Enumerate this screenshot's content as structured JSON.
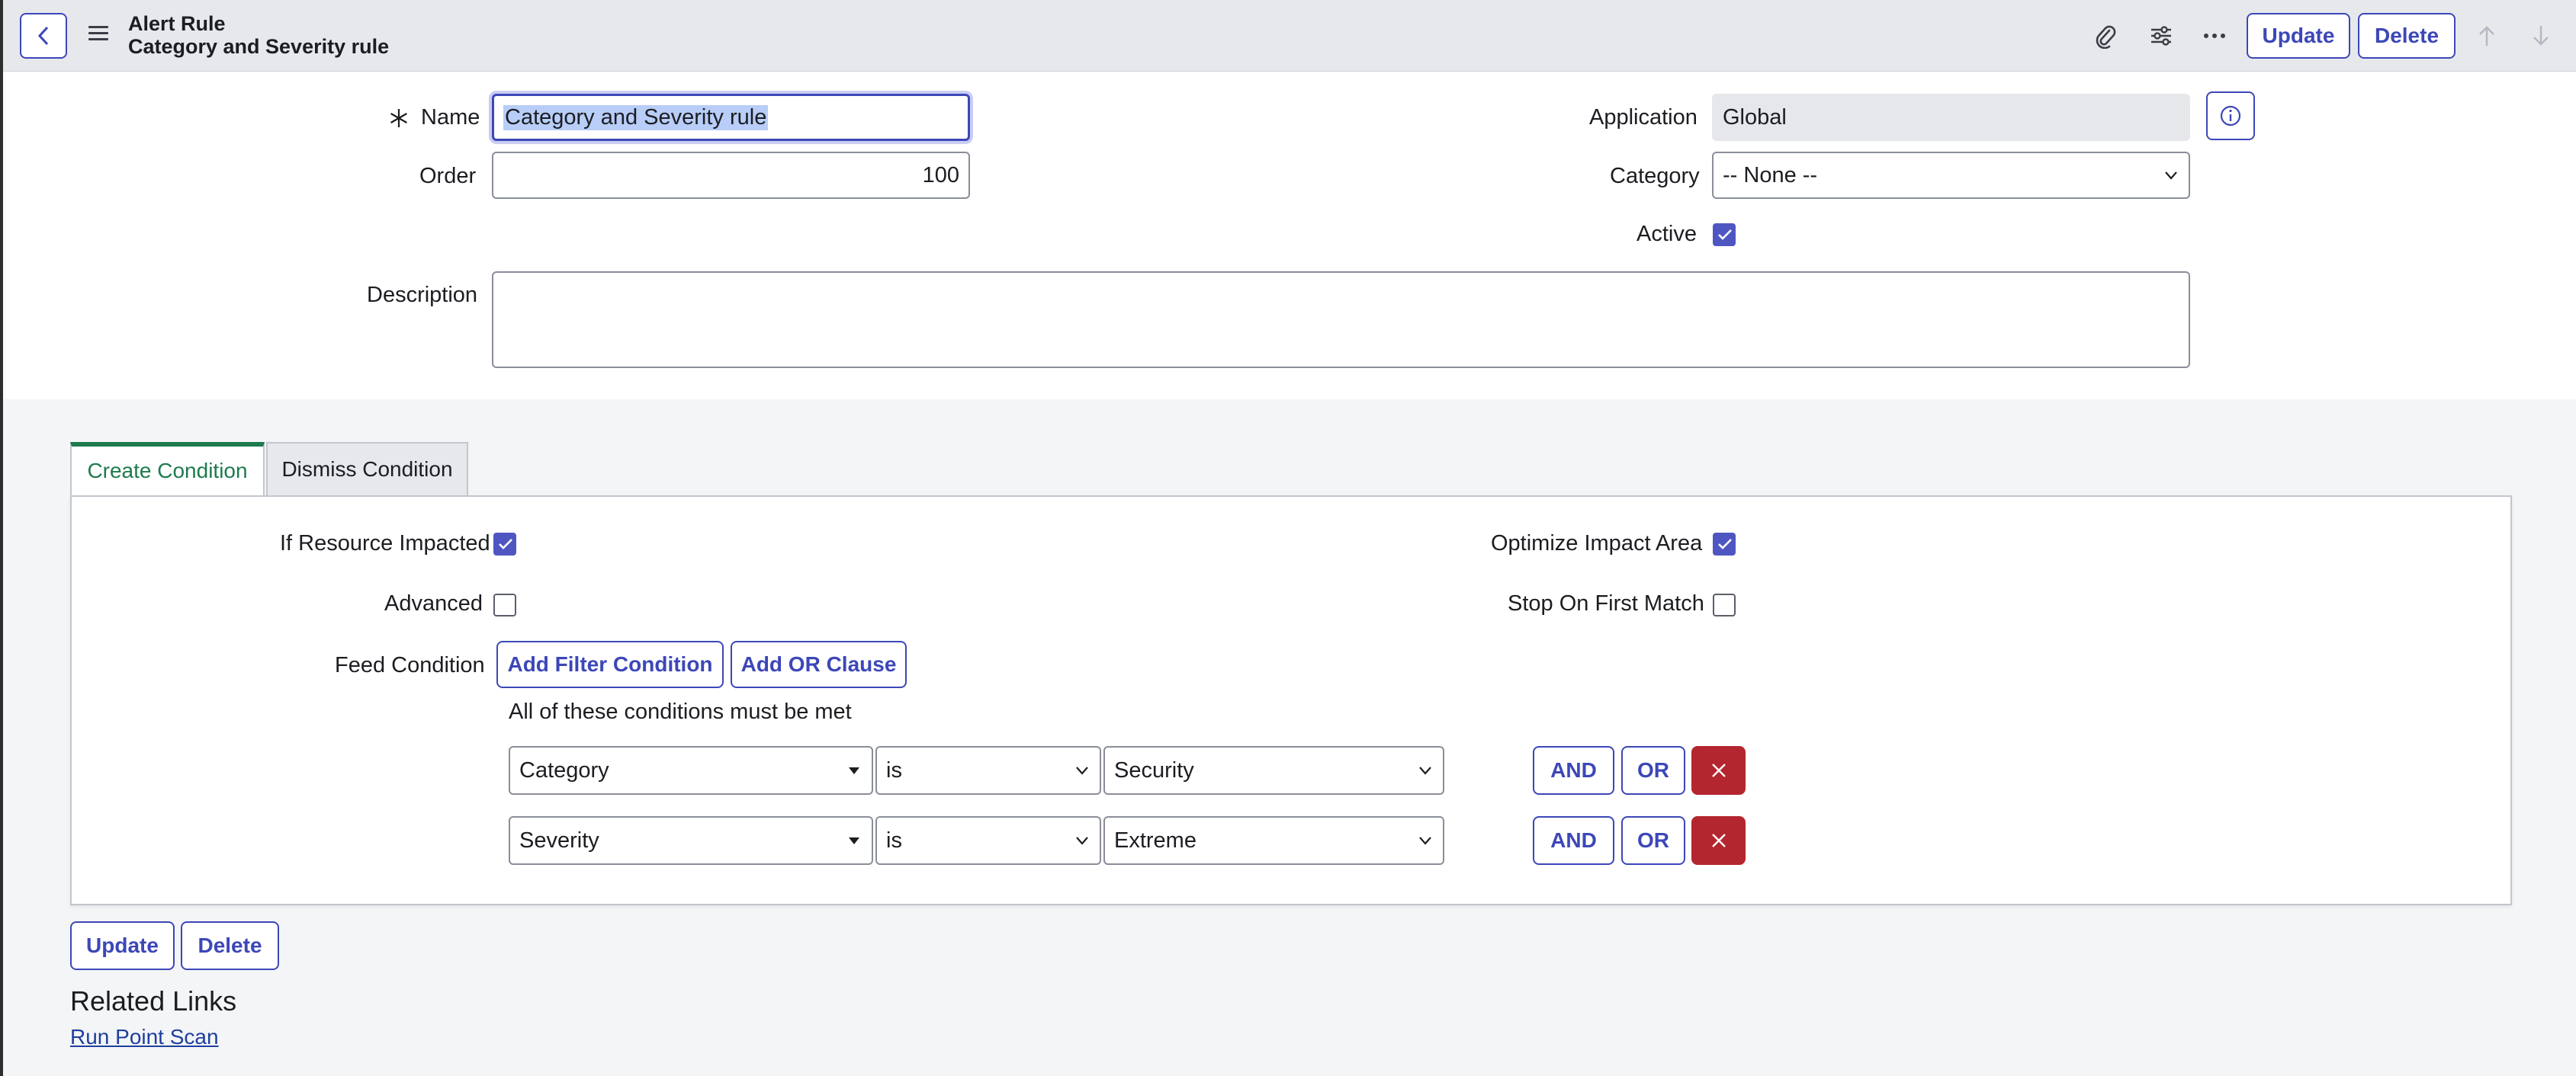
{
  "header": {
    "title": "Alert Rule",
    "subtitle": "Category and Severity rule",
    "update_label": "Update",
    "delete_label": "Delete"
  },
  "form": {
    "name_label": "Name",
    "name_value": "Category and Severity rule",
    "order_label": "Order",
    "order_value": "100",
    "application_label": "Application",
    "application_value": "Global",
    "category_label": "Category",
    "category_value": "-- None --",
    "active_label": "Active",
    "active_checked": true,
    "description_label": "Description",
    "description_value": ""
  },
  "tabs": [
    {
      "label": "Create Condition",
      "active": true
    },
    {
      "label": "Dismiss Condition",
      "active": false
    }
  ],
  "condition": {
    "if_resource_impacted_label": "If Resource Impacted",
    "if_resource_impacted_checked": true,
    "optimize_impact_area_label": "Optimize Impact Area",
    "optimize_impact_area_checked": true,
    "advanced_label": "Advanced",
    "advanced_checked": false,
    "stop_on_first_match_label": "Stop On First Match",
    "stop_on_first_match_checked": false,
    "feed_condition_label": "Feed Condition",
    "add_filter_label": "Add Filter Condition",
    "add_or_label": "Add OR Clause",
    "must_be_met_text": "All of these conditions must be met",
    "rows": [
      {
        "field": "Category",
        "operator": "is",
        "value": "Security"
      },
      {
        "field": "Severity",
        "operator": "is",
        "value": "Extreme"
      }
    ],
    "and_label": "AND",
    "or_label": "OR"
  },
  "footer": {
    "update_label": "Update",
    "delete_label": "Delete",
    "related_links_title": "Related Links",
    "run_point_scan_label": "Run Point Scan"
  },
  "colors": {
    "accent": "#3c47b8",
    "active_tab": "#1e7a4e",
    "danger": "#b3262f",
    "checkbox": "#4f56c2"
  }
}
